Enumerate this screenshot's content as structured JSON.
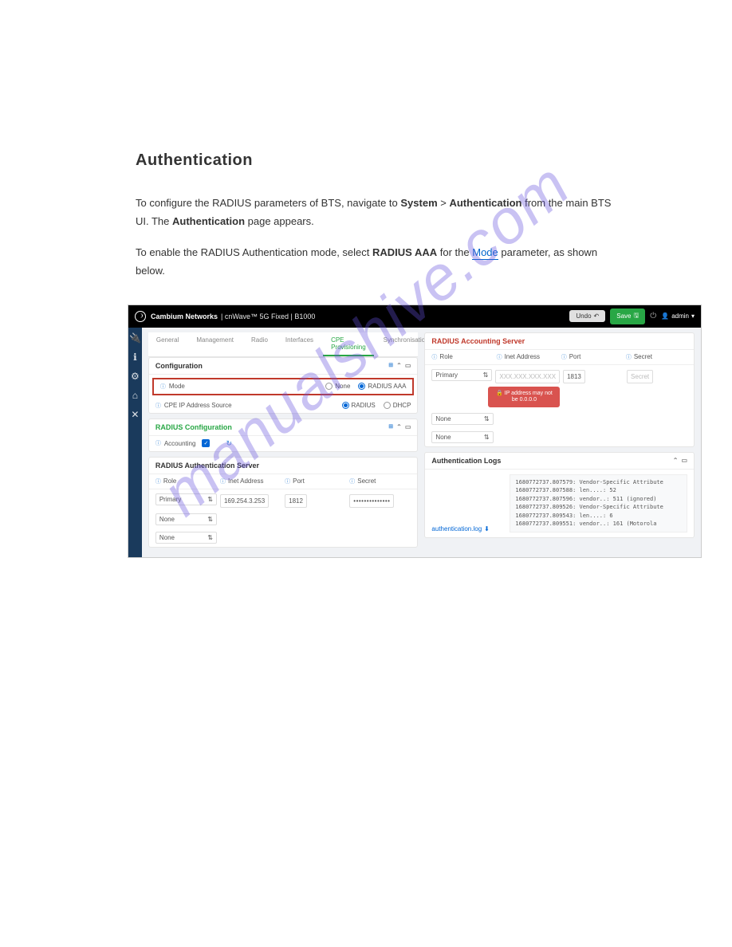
{
  "doc": {
    "heading": "Authentication",
    "para1_pre": "To configure the RADIUS parameters of BTS, navigate to ",
    "para1_system": "System",
    "para1_sep": " > ",
    "para1_auth": "Authentication",
    "para1_post": " from the main BTS ",
    "para1_line2_pre": "UI. The ",
    "para1_line2_auth": "Authentication",
    "para1_line2_post": " page appears.",
    "para2_pre": "To enable the RADIUS Authentication mode, select ",
    "para2_radius": "RADIUS AAA",
    "para2_mid": " for the ",
    "para2_mode": "Mode",
    "para2_post": " parameter, as shown ",
    "para2_line2": "below."
  },
  "topbar": {
    "brand": "Cambium Networks",
    "breadcrumb": "| cnWave™ 5G Fixed | B1000",
    "undo": "Undo",
    "save": "Save",
    "admin": "admin"
  },
  "tabs": {
    "general": "General",
    "management": "Management",
    "radio": "Radio",
    "interfaces": "Interfaces",
    "cpe": "CPE Provisioning",
    "sync": "Synchronisation"
  },
  "config": {
    "header": "Configuration",
    "mode_label": "Mode",
    "none": "None",
    "radius_aaa": "RADIUS AAA",
    "ip_src_label": "CPE IP Address Source",
    "radius": "RADIUS",
    "dhcp": "DHCP"
  },
  "radius_config": {
    "header": "RADIUS Configuration",
    "accounting": "Accounting"
  },
  "auth_server": {
    "header": "RADIUS Authentication Server",
    "role": "Role",
    "inet": "Inet Address",
    "port": "Port",
    "secret": "Secret",
    "primary": "Primary",
    "none": "None",
    "addr": "169.254.3.253",
    "port_val": "1812",
    "secret_val": "••••••••••••••"
  },
  "acct_server": {
    "header": "RADIUS Accounting Server",
    "role": "Role",
    "inet": "Inet Address",
    "port": "Port",
    "secret": "Secret",
    "primary": "Primary",
    "addr_placeholder": "XXX.XXX.XXX.XXX",
    "port_val": "1813",
    "secret_placeholder": "Secret",
    "none": "None",
    "error_l1": "IP address may not",
    "error_l2": "be 0.0.0.0"
  },
  "logs": {
    "header": "Authentication Logs",
    "link": "authentication.log",
    "l1": "1680772737.807579:  Vendor-Specific Attribute",
    "l2": "1680772737.807588:    len....: 52",
    "l3": "1680772737.807596:    vendor..: 511 (ignored)",
    "l4": "1680772737.809526:  Vendor-Specific Attribute",
    "l5": "1680772737.809543:    len....: 6",
    "l6": "1680772737.809551:    vendor..: 161 (Motorola"
  },
  "watermark": "manualshive.com"
}
